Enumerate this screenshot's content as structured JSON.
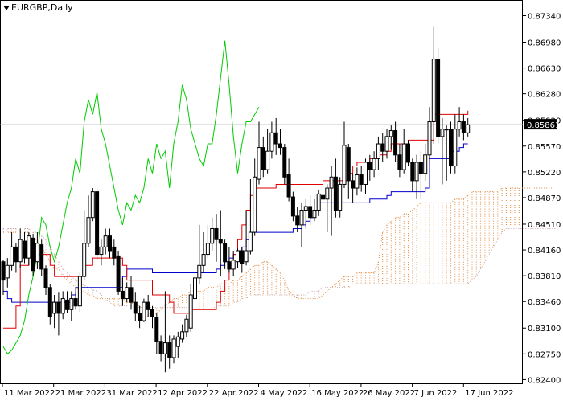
{
  "window": {
    "symbol_title": "EURGBP,Daily",
    "current_price": "0.85861"
  },
  "colors": {
    "bull": "#ffffff",
    "bear": "#000000",
    "outline": "#000000",
    "tenkan": "#e00000",
    "kijun": "#0000cc",
    "chikou": "#00cc00",
    "cloud": "#e08a40",
    "cloud_b": "#c9a0a0",
    "grid": "#c0c0c0"
  },
  "chart_data": {
    "type": "candlestick",
    "title": "EURGBP,Daily",
    "ylim": [
      0.8235,
      0.8752
    ],
    "y_ticks": [
      "0.87340",
      "0.86980",
      "0.86630",
      "0.86280",
      "0.85920",
      "0.85570",
      "0.85220",
      "0.84870",
      "0.84510",
      "0.84160",
      "0.83810",
      "0.83460",
      "0.83100",
      "0.82750",
      "0.82400"
    ],
    "x_labels": [
      "11 Mar 2022",
      "21 Mar 2022",
      "31 Mar 2022",
      "12 Apr 2022",
      "22 Apr 2022",
      "4 May 2022",
      "16 May 2022",
      "26 May 2022",
      "7 Jun 2022",
      "17 Jun 2022"
    ],
    "candles": [
      [
        0.84,
        0.8375,
        0.8402,
        0.8355
      ],
      [
        0.8378,
        0.8395,
        0.8405,
        0.8365
      ],
      [
        0.8395,
        0.842,
        0.844,
        0.8388
      ],
      [
        0.842,
        0.84,
        0.8425,
        0.8385
      ],
      [
        0.84,
        0.843,
        0.8445,
        0.8392
      ],
      [
        0.8428,
        0.8405,
        0.844,
        0.8398
      ],
      [
        0.8405,
        0.8435,
        0.844,
        0.8395
      ],
      [
        0.8432,
        0.8388,
        0.8438,
        0.838
      ],
      [
        0.84,
        0.8425,
        0.844,
        0.839
      ],
      [
        0.8423,
        0.839,
        0.843,
        0.838
      ],
      [
        0.839,
        0.8365,
        0.8395,
        0.8355
      ],
      [
        0.8365,
        0.8325,
        0.837,
        0.8315
      ],
      [
        0.833,
        0.8345,
        0.8355,
        0.831
      ],
      [
        0.8345,
        0.833,
        0.8358,
        0.83
      ],
      [
        0.833,
        0.835,
        0.836,
        0.8322
      ],
      [
        0.8348,
        0.8335,
        0.836,
        0.833
      ],
      [
        0.8335,
        0.835,
        0.836,
        0.832
      ],
      [
        0.835,
        0.834,
        0.8358,
        0.8335
      ],
      [
        0.834,
        0.838,
        0.8385,
        0.8332
      ],
      [
        0.838,
        0.8425,
        0.847,
        0.8375
      ],
      [
        0.8425,
        0.846,
        0.849,
        0.842
      ],
      [
        0.846,
        0.8495,
        0.85,
        0.8455
      ],
      [
        0.8495,
        0.841,
        0.8498,
        0.8402
      ],
      [
        0.841,
        0.842,
        0.843,
        0.8395
      ],
      [
        0.842,
        0.8435,
        0.8445,
        0.841
      ],
      [
        0.8435,
        0.8415,
        0.8445,
        0.8405
      ],
      [
        0.842,
        0.8405,
        0.843,
        0.8395
      ],
      [
        0.8408,
        0.836,
        0.8415,
        0.8355
      ],
      [
        0.836,
        0.835,
        0.8378,
        0.834
      ],
      [
        0.835,
        0.8365,
        0.8372,
        0.8345
      ],
      [
        0.8365,
        0.8345,
        0.838,
        0.8335
      ],
      [
        0.8345,
        0.833,
        0.8358,
        0.832
      ],
      [
        0.833,
        0.832,
        0.834,
        0.831
      ],
      [
        0.832,
        0.8345,
        0.835,
        0.8318
      ],
      [
        0.8345,
        0.8335,
        0.8355,
        0.8325
      ],
      [
        0.8335,
        0.8325,
        0.834,
        0.831
      ],
      [
        0.8325,
        0.8292,
        0.833,
        0.8275
      ],
      [
        0.8292,
        0.8275,
        0.83,
        0.8265
      ],
      [
        0.8275,
        0.829,
        0.836,
        0.825
      ],
      [
        0.829,
        0.827,
        0.83,
        0.8255
      ],
      [
        0.827,
        0.8295,
        0.83,
        0.8262
      ],
      [
        0.8285,
        0.8298,
        0.8305,
        0.827
      ],
      [
        0.8295,
        0.8305,
        0.8315,
        0.829
      ],
      [
        0.8305,
        0.8322,
        0.8328,
        0.8298
      ],
      [
        0.831,
        0.8355,
        0.837,
        0.8305
      ],
      [
        0.835,
        0.8378,
        0.8405,
        0.8345
      ],
      [
        0.8378,
        0.8395,
        0.845,
        0.837
      ],
      [
        0.8395,
        0.841,
        0.844,
        0.8385
      ],
      [
        0.841,
        0.8425,
        0.845,
        0.8405
      ],
      [
        0.8425,
        0.8445,
        0.846,
        0.8415
      ],
      [
        0.8445,
        0.843,
        0.8465,
        0.84
      ],
      [
        0.843,
        0.8425,
        0.847,
        0.838
      ],
      [
        0.8425,
        0.84,
        0.843,
        0.839
      ],
      [
        0.84,
        0.839,
        0.842,
        0.8385
      ],
      [
        0.839,
        0.8402,
        0.8415,
        0.838
      ],
      [
        0.84,
        0.8415,
        0.8418,
        0.8392
      ],
      [
        0.8415,
        0.8398,
        0.842,
        0.8385
      ],
      [
        0.84,
        0.8415,
        0.847,
        0.8395
      ],
      [
        0.8415,
        0.844,
        0.8512,
        0.841
      ],
      [
        0.844,
        0.8515,
        0.854,
        0.8435
      ],
      [
        0.8512,
        0.8555,
        0.859,
        0.8505
      ],
      [
        0.8555,
        0.8525,
        0.857,
        0.8515
      ],
      [
        0.8525,
        0.855,
        0.858,
        0.852
      ],
      [
        0.855,
        0.8575,
        0.859,
        0.854
      ],
      [
        0.8575,
        0.856,
        0.8595,
        0.8545
      ],
      [
        0.856,
        0.8555,
        0.858,
        0.8545
      ],
      [
        0.8555,
        0.8515,
        0.856,
        0.8505
      ],
      [
        0.8518,
        0.8488,
        0.854,
        0.8482
      ],
      [
        0.8488,
        0.8462,
        0.8495,
        0.8455
      ],
      [
        0.8462,
        0.845,
        0.8475,
        0.844
      ],
      [
        0.845,
        0.847,
        0.848,
        0.842
      ],
      [
        0.847,
        0.8475,
        0.8485,
        0.8445
      ],
      [
        0.8475,
        0.846,
        0.849,
        0.845
      ],
      [
        0.846,
        0.847,
        0.8485,
        0.8455
      ],
      [
        0.847,
        0.8492,
        0.8498,
        0.8462
      ],
      [
        0.849,
        0.8485,
        0.851,
        0.847
      ],
      [
        0.8485,
        0.85,
        0.8505,
        0.844
      ],
      [
        0.85,
        0.8515,
        0.853,
        0.8435
      ],
      [
        0.8515,
        0.847,
        0.854,
        0.846
      ],
      [
        0.847,
        0.8505,
        0.8515,
        0.846
      ],
      [
        0.8505,
        0.8558,
        0.859,
        0.85
      ],
      [
        0.8555,
        0.851,
        0.856,
        0.8485
      ],
      [
        0.851,
        0.85,
        0.852,
        0.848
      ],
      [
        0.85,
        0.8518,
        0.8528,
        0.849
      ],
      [
        0.8518,
        0.8505,
        0.853,
        0.8495
      ],
      [
        0.8505,
        0.8535,
        0.854,
        0.8492
      ],
      [
        0.8535,
        0.8525,
        0.8545,
        0.851
      ],
      [
        0.8525,
        0.854,
        0.855,
        0.8515
      ],
      [
        0.854,
        0.856,
        0.857,
        0.8525
      ],
      [
        0.856,
        0.855,
        0.8575,
        0.8535
      ],
      [
        0.855,
        0.857,
        0.858,
        0.854
      ],
      [
        0.857,
        0.8578,
        0.8585,
        0.8552
      ],
      [
        0.8578,
        0.8545,
        0.859,
        0.8535
      ],
      [
        0.8545,
        0.8525,
        0.856,
        0.8515
      ],
      [
        0.8525,
        0.856,
        0.858,
        0.852
      ],
      [
        0.856,
        0.8535,
        0.8565,
        0.853
      ],
      [
        0.8535,
        0.851,
        0.854,
        0.8495
      ],
      [
        0.851,
        0.8535,
        0.8545,
        0.8485
      ],
      [
        0.8535,
        0.852,
        0.855,
        0.8485
      ],
      [
        0.852,
        0.8545,
        0.856,
        0.851
      ],
      [
        0.8545,
        0.859,
        0.861,
        0.8535
      ],
      [
        0.859,
        0.8675,
        0.872,
        0.856
      ],
      [
        0.8675,
        0.857,
        0.869,
        0.856
      ],
      [
        0.857,
        0.858,
        0.8595,
        0.8505
      ],
      [
        0.858,
        0.858,
        0.8585,
        0.851
      ],
      [
        0.858,
        0.853,
        0.859,
        0.852
      ],
      [
        0.853,
        0.858,
        0.86,
        0.852
      ],
      [
        0.858,
        0.859,
        0.861,
        0.857
      ],
      [
        0.859,
        0.8575,
        0.86,
        0.8565
      ],
      [
        0.8575,
        0.8586,
        0.8595,
        0.857
      ]
    ],
    "tenkan": [
      0.831,
      0.831,
      0.831,
      0.834,
      0.8395,
      0.8395,
      0.841,
      0.841,
      0.841,
      0.841,
      0.841,
      0.8395,
      0.838,
      0.838,
      0.838,
      0.838,
      0.838,
      0.838,
      0.838,
      0.8395,
      0.8395,
      0.8405,
      0.8405,
      0.8405,
      0.8405,
      0.8405,
      0.8405,
      0.8405,
      0.8395,
      0.8375,
      0.8375,
      0.8375,
      0.8375,
      0.8375,
      0.8375,
      0.8355,
      0.8355,
      0.8355,
      0.8355,
      0.8345,
      0.833,
      0.833,
      0.833,
      0.833,
      0.8335,
      0.8335,
      0.8335,
      0.8335,
      0.8335,
      0.8335,
      0.8345,
      0.836,
      0.8375,
      0.839,
      0.841,
      0.843,
      0.845,
      0.847,
      0.849,
      0.85,
      0.85,
      0.85,
      0.85,
      0.85,
      0.8505,
      0.8505,
      0.8505,
      0.8505,
      0.8505,
      0.8505,
      0.8505,
      0.8505,
      0.8505,
      0.8505,
      0.8505,
      0.851,
      0.851,
      0.851,
      0.851,
      0.851,
      0.851,
      0.852,
      0.853,
      0.8535,
      0.8535,
      0.8535,
      0.854,
      0.854,
      0.8545,
      0.8545,
      0.855,
      0.856,
      0.856,
      0.856,
      0.856,
      0.8565,
      0.8565,
      0.8565,
      0.8565,
      0.8565,
      0.8565,
      0.86,
      0.86,
      0.86,
      0.86,
      0.86,
      0.86,
      0.86,
      0.86,
      0.8605
    ],
    "kijun": [
      0.836,
      0.835,
      0.8345,
      0.8345,
      0.8345,
      0.8345,
      0.8345,
      0.8345,
      0.8345,
      0.8345,
      0.8345,
      0.8345,
      0.8345,
      0.8345,
      0.8345,
      0.8345,
      0.8355,
      0.8365,
      0.8365,
      0.8365,
      0.8365,
      0.8365,
      0.8365,
      0.8365,
      0.8365,
      0.8365,
      0.8365,
      0.8365,
      0.838,
      0.839,
      0.839,
      0.839,
      0.839,
      0.839,
      0.839,
      0.8385,
      0.8385,
      0.8385,
      0.8385,
      0.8385,
      0.8385,
      0.8385,
      0.8385,
      0.8385,
      0.8385,
      0.8385,
      0.8385,
      0.8385,
      0.8385,
      0.8385,
      0.839,
      0.8395,
      0.84,
      0.8405,
      0.841,
      0.8415,
      0.842,
      0.843,
      0.844,
      0.844,
      0.844,
      0.844,
      0.844,
      0.844,
      0.844,
      0.844,
      0.844,
      0.844,
      0.8445,
      0.8445,
      0.845,
      0.8455,
      0.846,
      0.847,
      0.848,
      0.848,
      0.848,
      0.848,
      0.848,
      0.848,
      0.848,
      0.848,
      0.848,
      0.848,
      0.848,
      0.848,
      0.8485,
      0.8485,
      0.8485,
      0.8485,
      0.849,
      0.8495,
      0.8495,
      0.8495,
      0.8495,
      0.8495,
      0.8495,
      0.8495,
      0.8495,
      0.85,
      0.854,
      0.854,
      0.854,
      0.854,
      0.854,
      0.855,
      0.855,
      0.8555,
      0.856,
      0.856
    ],
    "chikou": [
      0.8285,
      0.8275,
      0.828,
      0.829,
      0.83,
      0.832,
      0.8355,
      0.838,
      0.841,
      0.846,
      0.845,
      0.842,
      0.84,
      0.842,
      0.845,
      0.848,
      0.85,
      0.854,
      0.852,
      0.859,
      0.862,
      0.86,
      0.863,
      0.858,
      0.856,
      0.853,
      0.85,
      0.847,
      0.845,
      0.848,
      0.847,
      0.849,
      0.848,
      0.85,
      0.854,
      0.852,
      0.856,
      0.854,
      0.855,
      0.85,
      0.856,
      0.859,
      0.864,
      0.862,
      0.858,
      0.856,
      0.854,
      0.853,
      0.856,
      0.856,
      0.86,
      0.865,
      0.87,
      0.864,
      0.857,
      0.852,
      0.856,
      0.859,
      0.859,
      0.86,
      0.861
    ],
    "senkou_a": [
      0.844,
      0.844,
      0.844,
      0.844,
      0.844,
      0.844,
      0.844,
      0.843,
      0.843,
      0.842,
      0.841,
      0.84,
      0.839,
      0.839,
      0.838,
      0.8375,
      0.837,
      0.8365,
      0.836,
      0.836,
      0.8355,
      0.8355,
      0.835,
      0.835,
      0.835,
      0.835,
      0.835,
      0.835,
      0.835,
      0.8345,
      0.8345,
      0.834,
      0.834,
      0.833,
      0.8325,
      0.8325,
      0.833,
      0.8335,
      0.834,
      0.8345,
      0.835,
      0.835,
      0.8355,
      0.8355,
      0.836,
      0.836,
      0.836,
      0.836,
      0.8365,
      0.8365,
      0.8365,
      0.837,
      0.837,
      0.837,
      0.8375,
      0.8375,
      0.838,
      0.8385,
      0.839,
      0.8395,
      0.8395,
      0.84,
      0.84,
      0.8395,
      0.839,
      0.8385,
      0.8375,
      0.836,
      0.8355,
      0.835,
      0.835,
      0.835,
      0.835,
      0.835,
      0.835,
      0.8355,
      0.836,
      0.8365,
      0.837,
      0.8375,
      0.838,
      0.838,
      0.838,
      0.8385,
      0.8385,
      0.8385,
      0.8385,
      0.8385,
      0.84,
      0.844,
      0.845,
      0.8455,
      0.846,
      0.846,
      0.8465,
      0.8465,
      0.847,
      0.8475,
      0.848,
      0.848,
      0.848,
      0.848,
      0.848,
      0.848,
      0.848,
      0.848,
      0.8485,
      0.8485,
      0.8485,
      0.849,
      0.8495,
      0.8495,
      0.8495,
      0.8495,
      0.8495,
      0.8495,
      0.8495,
      0.85,
      0.85,
      0.85,
      0.85,
      0.85,
      0.85,
      0.85,
      0.85,
      0.85,
      0.85,
      0.85,
      0.85,
      0.85
    ],
    "senkou_b": [
      0.8445,
      0.8445,
      0.8445,
      0.8445,
      0.8445,
      0.8445,
      0.8445,
      0.844,
      0.844,
      0.8435,
      0.843,
      0.842,
      0.841,
      0.84,
      0.839,
      0.8385,
      0.838,
      0.8375,
      0.837,
      0.8368,
      0.8365,
      0.8362,
      0.836,
      0.8355,
      0.835,
      0.8345,
      0.834,
      0.834,
      0.834,
      0.834,
      0.834,
      0.8338,
      0.8338,
      0.8338,
      0.8338,
      0.8338,
      0.8338,
      0.8338,
      0.8338,
      0.8338,
      0.8338,
      0.8338,
      0.8338,
      0.8338,
      0.8338,
      0.8335,
      0.8335,
      0.8335,
      0.8335,
      0.8335,
      0.834,
      0.834,
      0.834,
      0.834,
      0.8345,
      0.8345,
      0.835,
      0.835,
      0.8355,
      0.8355,
      0.8355,
      0.8355,
      0.8355,
      0.8355,
      0.8355,
      0.8355,
      0.8355,
      0.8355,
      0.8355,
      0.8355,
      0.8355,
      0.8355,
      0.836,
      0.836,
      0.836,
      0.8365,
      0.8365,
      0.8365,
      0.8365,
      0.8365,
      0.8365,
      0.8365,
      0.837,
      0.837,
      0.837,
      0.837,
      0.837,
      0.837,
      0.837,
      0.837,
      0.837,
      0.837,
      0.837,
      0.837,
      0.837,
      0.837,
      0.837,
      0.837,
      0.837,
      0.837,
      0.837,
      0.837,
      0.837,
      0.837,
      0.837,
      0.837,
      0.837,
      0.837,
      0.837,
      0.837,
      0.8375,
      0.838,
      0.839,
      0.84,
      0.841,
      0.842,
      0.843,
      0.844,
      0.8445,
      0.8445,
      0.8445,
      0.8445,
      0.8445,
      0.8445,
      0.8445,
      0.8445,
      0.8445,
      0.8445,
      0.8445,
      0.8445,
      0.8445
    ]
  }
}
